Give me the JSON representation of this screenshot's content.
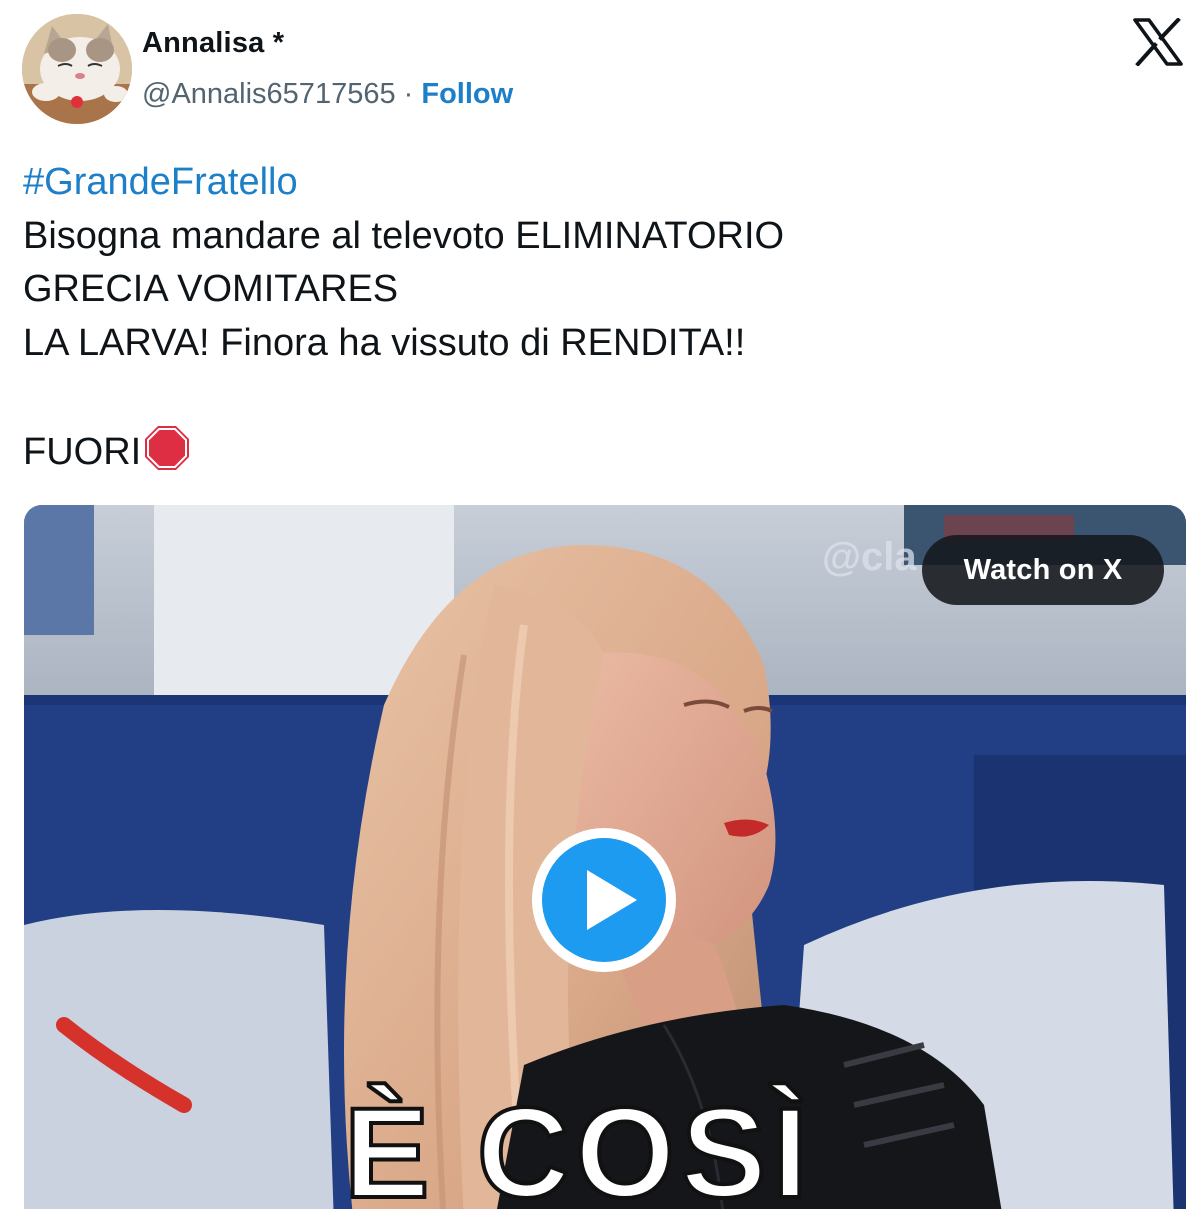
{
  "author": {
    "display_name": "Annalisa *",
    "handle": "@Annalis65717565",
    "separator": " · ",
    "follow_label": "Follow",
    "avatar_icon": "cat-avatar"
  },
  "platform": {
    "logo_icon": "x-logo-icon"
  },
  "tweet": {
    "hashtag": "#GrandeFratello",
    "lines": [
      "Bisogna mandare al televoto ELIMINATORIO",
      "GRECIA VOMITARES",
      "LA LARVA! Finora ha vissuto di RENDITA!!",
      "",
      "FUORI"
    ],
    "emoji_icon": "stop-sign-icon"
  },
  "media": {
    "watch_label": "Watch on X",
    "watermark": "@cla",
    "caption": "È COSÌ",
    "play_icon": "play-icon"
  },
  "colors": {
    "link": "#1d7fc8",
    "text": "#0f1419",
    "muted": "#536471",
    "play_blue": "#1d9bf0",
    "stop_red": "#dd2e44"
  }
}
